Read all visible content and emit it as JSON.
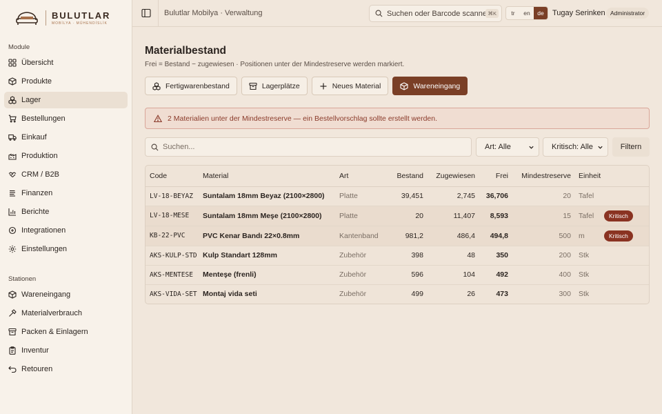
{
  "brand": {
    "name": "BULUTLAR",
    "tagline": "MOBİLYA · MÜHENDİSLİK"
  },
  "sidebar": {
    "modules_label": "Module",
    "modules": [
      {
        "label": "Übersicht",
        "icon": "grid-icon"
      },
      {
        "label": "Produkte",
        "icon": "package-icon"
      },
      {
        "label": "Lager",
        "icon": "boxes-icon",
        "active": true
      },
      {
        "label": "Bestellungen",
        "icon": "cart-icon"
      },
      {
        "label": "Einkauf",
        "icon": "truck-icon"
      },
      {
        "label": "Produktion",
        "icon": "factory-icon"
      },
      {
        "label": "CRM / B2B",
        "icon": "handshake-icon"
      },
      {
        "label": "Finanzen",
        "icon": "coins-icon"
      },
      {
        "label": "Berichte",
        "icon": "bar-chart-icon"
      },
      {
        "label": "Integrationen",
        "icon": "plug-icon"
      },
      {
        "label": "Einstellungen",
        "icon": "gear-icon"
      }
    ],
    "stations_label": "Stationen",
    "stations": [
      {
        "label": "Wareneingang",
        "icon": "package-icon"
      },
      {
        "label": "Materialverbrauch",
        "icon": "hammer-icon"
      },
      {
        "label": "Packen & Einlagern",
        "icon": "archive-icon"
      },
      {
        "label": "Inventur",
        "icon": "clipboard-icon"
      },
      {
        "label": "Retouren",
        "icon": "undo-icon"
      }
    ]
  },
  "topbar": {
    "breadcrumb": "Bulutlar Mobilya · Verwaltung",
    "search_placeholder": "Suchen oder Barcode scannen",
    "search_shortcut": "⌘K",
    "languages": [
      "tr",
      "en",
      "de"
    ],
    "active_language": "de",
    "user_name": "Tugay Serinken",
    "user_role": "Administrator"
  },
  "page": {
    "title": "Materialbestand",
    "subtitle": "Frei = Bestand − zugewiesen · Positionen unter der Mindestreserve werden markiert.",
    "actions": [
      {
        "label": "Fertigwarenbestand",
        "icon": "boxes-icon"
      },
      {
        "label": "Lagerplätze",
        "icon": "archive-icon"
      },
      {
        "label": "Neues Material",
        "icon": "plus-icon"
      },
      {
        "label": "Wareneingang",
        "icon": "package-icon",
        "primary": true
      }
    ],
    "alert": "2 Materialien unter der Mindestreserve — ein Bestellvorschlag sollte erstellt werden.",
    "filters": {
      "search_placeholder": "Suchen...",
      "art_selected": "Art: Alle",
      "kritisch_selected": "Kritisch: Alle",
      "button": "Filtern"
    },
    "table": {
      "columns": [
        "Code",
        "Material",
        "Art",
        "Bestand",
        "Zugewiesen",
        "Frei",
        "Mindestreserve",
        "Einheit",
        ""
      ],
      "rows": [
        {
          "code": "LV-18-BEYAZ",
          "material": "Suntalam 18mm Beyaz (2100×2800)",
          "art": "Platte",
          "bestand": "39,451",
          "zugewiesen": "2,745",
          "frei": "36,706",
          "mindest": "20",
          "einheit": "Tafel",
          "badge": ""
        },
        {
          "code": "LV-18-MESE",
          "material": "Suntalam 18mm Meşe (2100×2800)",
          "art": "Platte",
          "bestand": "20",
          "zugewiesen": "11,407",
          "frei": "8,593",
          "mindest": "15",
          "einheit": "Tafel",
          "badge": "Kritisch"
        },
        {
          "code": "KB-22-PVC",
          "material": "PVC Kenar Bandı 22×0.8mm",
          "art": "Kantenband",
          "bestand": "981,2",
          "zugewiesen": "486,4",
          "frei": "494,8",
          "mindest": "500",
          "einheit": "m",
          "badge": "Kritisch"
        },
        {
          "code": "AKS-KULP-STD",
          "material": "Kulp Standart 128mm",
          "art": "Zubehör",
          "bestand": "398",
          "zugewiesen": "48",
          "frei": "350",
          "mindest": "200",
          "einheit": "Stk",
          "badge": ""
        },
        {
          "code": "AKS-MENTESE",
          "material": "Menteşe (frenli)",
          "art": "Zubehör",
          "bestand": "596",
          "zugewiesen": "104",
          "frei": "492",
          "mindest": "400",
          "einheit": "Stk",
          "badge": ""
        },
        {
          "code": "AKS-VIDA-SET",
          "material": "Montaj vida seti",
          "art": "Zubehör",
          "bestand": "499",
          "zugewiesen": "26",
          "frei": "473",
          "mindest": "300",
          "einheit": "Stk",
          "badge": ""
        }
      ]
    }
  },
  "colors": {
    "accent": "#7a3f26",
    "critical": "#8a3322",
    "alert_bg": "#f0ddd2",
    "page_bg": "#f1e7dc"
  }
}
